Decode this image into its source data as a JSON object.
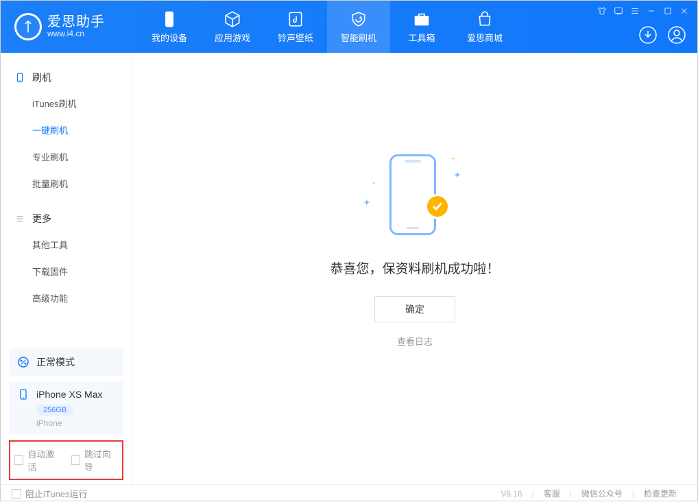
{
  "app": {
    "name": "爱思助手",
    "url": "www.i4.cn"
  },
  "tabs": [
    {
      "label": "我的设备"
    },
    {
      "label": "应用游戏"
    },
    {
      "label": "铃声壁纸"
    },
    {
      "label": "智能刷机"
    },
    {
      "label": "工具箱"
    },
    {
      "label": "爱思商城"
    }
  ],
  "sidebar": {
    "group1": {
      "title": "刷机",
      "items": [
        "iTunes刷机",
        "一键刷机",
        "专业刷机",
        "批量刷机"
      ]
    },
    "group2": {
      "title": "更多",
      "items": [
        "其他工具",
        "下载固件",
        "高级功能"
      ]
    }
  },
  "mode": {
    "label": "正常模式"
  },
  "device": {
    "name": "iPhone XS Max",
    "storage": "256GB",
    "type": "iPhone"
  },
  "options": {
    "auto_activate": "自动激活",
    "skip_guide": "跳过向导"
  },
  "main": {
    "success_text": "恭喜您，保资料刷机成功啦！",
    "ok": "确定",
    "view_log": "查看日志"
  },
  "footer": {
    "block_itunes": "阻止iTunes运行",
    "version": "V8.16",
    "support": "客服",
    "wechat": "微信公众号",
    "update": "检查更新"
  }
}
